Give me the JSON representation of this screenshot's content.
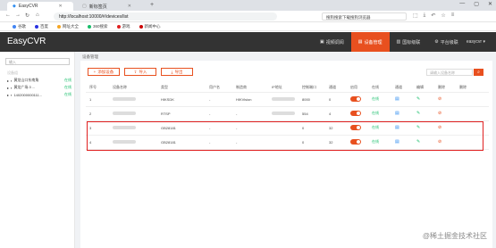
{
  "browser": {
    "tabs": [
      {
        "title": "EasyCVR",
        "active": true
      },
      {
        "title": "新标签页",
        "active": false
      }
    ],
    "url": "http://localhost:10000/#/devices/list",
    "search_text": "搜狗搜索下载搜狗浏览器",
    "bookmarks": [
      "谷歌",
      "百度",
      "网址大全",
      "360搜索",
      "游戏",
      "新闻中心"
    ]
  },
  "app": {
    "title": "EasyCVR",
    "nav": [
      {
        "label": "视频调阅",
        "icon": "video-icon",
        "active": false
      },
      {
        "label": "设备管理",
        "icon": "device-icon",
        "active": true
      },
      {
        "label": "国标级联",
        "icon": "cascade-icon",
        "active": false
      },
      {
        "label": "平台级联",
        "icon": "platform-icon",
        "active": false
      }
    ],
    "user": "easycvr"
  },
  "sidebar": {
    "search_placeholder": "输入",
    "root": "设备组",
    "items": [
      {
        "label": "黄龙山口东南角",
        "status": "在线"
      },
      {
        "label": "黄龙广场.3 ...",
        "status": "在线"
      },
      {
        "label": "1402000000111...",
        "status": "在线"
      }
    ]
  },
  "main": {
    "breadcrumb": "设备管理",
    "buttons": {
      "add": "添加设备",
      "import": "导入",
      "export": "导出"
    },
    "search_placeholder": "请输入设备名称",
    "columns": [
      "序号",
      "设备名称",
      "类型",
      "用户名",
      "制造商",
      "IP地址",
      "控制端口",
      "通道",
      "启用",
      "在线",
      "通道",
      "编辑",
      "删除",
      "删除"
    ],
    "rows": [
      {
        "idx": "1",
        "type": "HIKSDK",
        "user": "-",
        "maker": "HIKVision",
        "port": "8000",
        "channels": "0",
        "status": "在线"
      },
      {
        "idx": "2",
        "type": "RTSP",
        "user": "-",
        "maker": "-",
        "port": "554",
        "channels": "4",
        "status": "在线"
      },
      {
        "idx": "3",
        "type": "GB28181",
        "user": "-",
        "maker": "-",
        "port": "0",
        "channels": "32",
        "status": "在线"
      },
      {
        "idx": "4",
        "type": "GB28181",
        "user": "-",
        "maker": "-",
        "port": "0",
        "channels": "32",
        "status": "在线"
      }
    ]
  },
  "watermark": "@稀土掘金技术社区",
  "colors": {
    "accent": "#e8501f",
    "online": "#19be6b",
    "highlight": "#e02020",
    "header": "#333333"
  }
}
